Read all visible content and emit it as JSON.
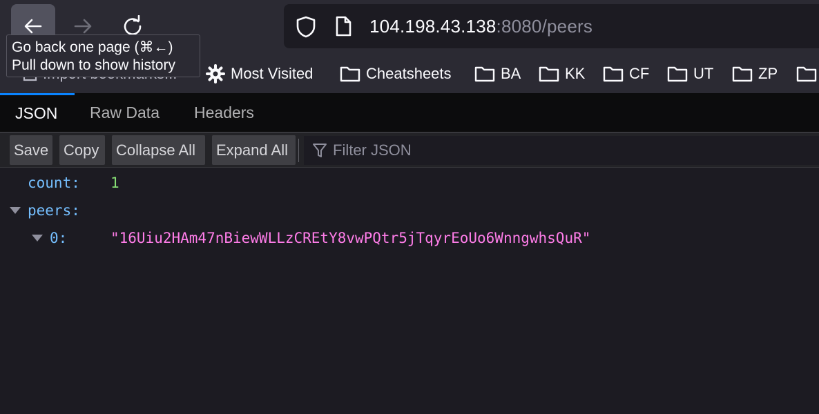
{
  "browser": {
    "url_host": "104.198.43.138",
    "url_rest": ":8080/peers",
    "tooltip_line1": "Go back one page (⌘←)",
    "tooltip_line2": "Pull down to show history"
  },
  "bookmarks": {
    "import_label": "Import bookmarks...",
    "items": [
      "Most Visited",
      "Cheatsheets",
      "BA",
      "KK",
      "CF",
      "UT",
      "ZP"
    ]
  },
  "viewer": {
    "tabs": [
      "JSON",
      "Raw Data",
      "Headers"
    ],
    "buttons": {
      "save": "Save",
      "copy": "Copy",
      "collapse": "Collapse All",
      "expand": "Expand All"
    },
    "filter_placeholder": "Filter JSON"
  },
  "json": {
    "count_key": "count:",
    "count_value": "1",
    "peers_key": "peers:",
    "index_key": "0:",
    "peer_value": "\"16Uiu2HAm47nBiewWLLzCREtY8vwPQtr5jTqyrEoUo6WnngwhsQuR\""
  }
}
